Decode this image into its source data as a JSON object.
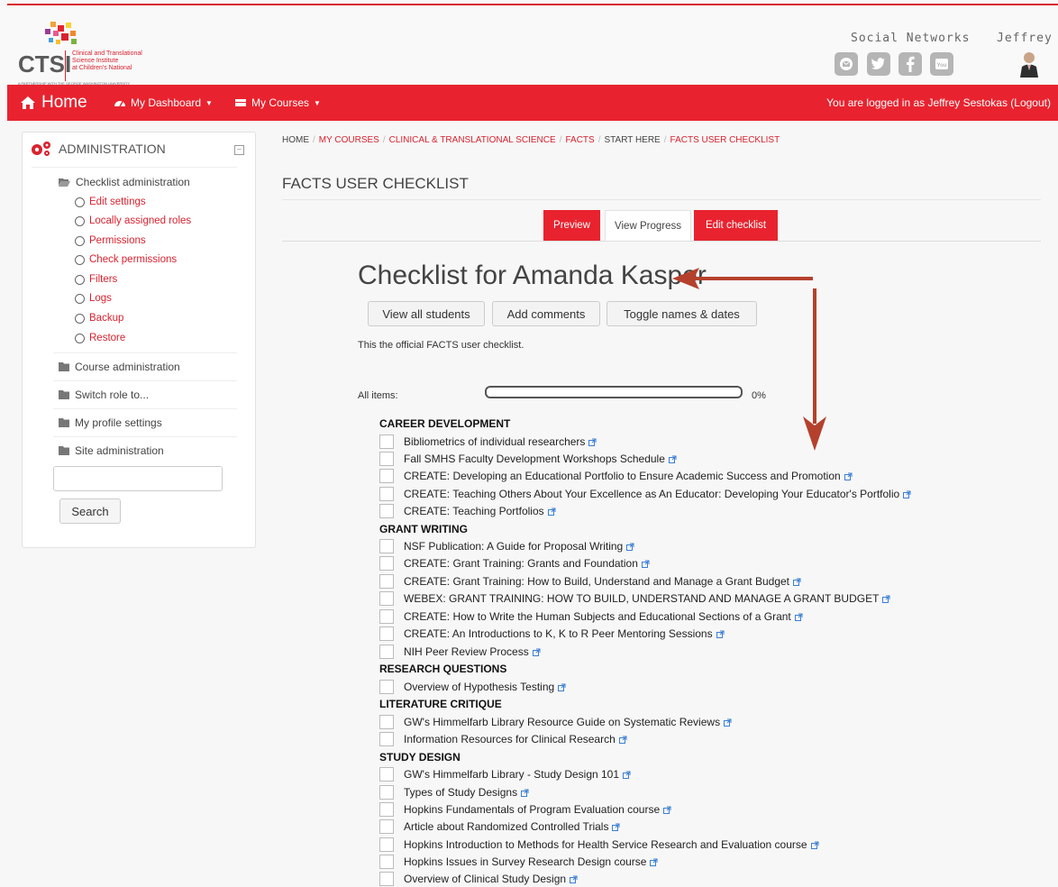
{
  "header": {
    "logo_main": "CTSI",
    "logo_sub": [
      "Clinical and Translational",
      "Science Institute",
      "at Children's National"
    ],
    "logo_foot": "A PARTNERSHIP WITH THE GEORGE WASHINGTON UNIVERSITY",
    "social_label": "Social Networks",
    "user_label": "Jeffrey",
    "social_icons": [
      "email-icon",
      "twitter-icon",
      "facebook-icon",
      "youtube-icon"
    ]
  },
  "nav": {
    "home": "Home",
    "dashboard": "My Dashboard",
    "courses": "My Courses",
    "login": "You are logged in as Jeffrey Sestokas (Logout)"
  },
  "sidebar": {
    "title": "ADMINISTRATION",
    "checklist_admin": "Checklist administration",
    "links": [
      "Edit settings",
      "Locally assigned roles",
      "Permissions",
      "Check permissions",
      "Filters",
      "Logs",
      "Backup",
      "Restore"
    ],
    "folders": [
      "Course administration",
      "Switch role to...",
      "My profile settings",
      "Site administration"
    ],
    "search_value": "",
    "search_button": "Search"
  },
  "breadcrumb": [
    "HOME",
    "MY COURSES",
    "CLINICAL & TRANSLATIONAL SCIENCE",
    "FACTS",
    "START HERE",
    "FACTS USER CHECKLIST"
  ],
  "page_title": "FACTS USER CHECKLIST",
  "tabs": [
    "Preview",
    "View Progress",
    "Edit checklist"
  ],
  "heading": "Checklist for Amanda Kasper",
  "buttons": [
    "View all students",
    "Add comments",
    "Toggle names & dates"
  ],
  "description": "This the official FACTS user checklist.",
  "progress": {
    "label": "All items:",
    "percent_text": "0%",
    "value": 0
  },
  "colors": {
    "accent": "#e8232f",
    "arrow": "#b5412c"
  },
  "checklist": [
    {
      "category": "CAREER DEVELOPMENT",
      "items": [
        "Bibliometrics of individual researchers",
        "Fall SMHS Faculty Development Workshops Schedule",
        "CREATE: Developing an Educational Portfolio to Ensure Academic Success and Promotion",
        "CREATE: Teaching Others About Your Excellence as An Educator: Developing Your Educator's Portfolio",
        "CREATE: Teaching Portfolios"
      ]
    },
    {
      "category": "GRANT WRITING",
      "items": [
        "NSF Publication: A Guide for Proposal Writing",
        "CREATE: Grant Training: Grants and Foundation",
        "CREATE: Grant Training: How to Build, Understand and Manage a Grant Budget",
        "WEBEX: GRANT TRAINING: HOW TO BUILD, UNDERSTAND AND MANAGE A GRANT BUDGET",
        "CREATE: How to Write the Human Subjects and Educational Sections of a Grant",
        "CREATE: An Introductions to K, K to R Peer Mentoring Sessions",
        "NIH Peer Review Process"
      ]
    },
    {
      "category": "RESEARCH QUESTIONS",
      "items": [
        "Overview of Hypothesis Testing"
      ]
    },
    {
      "category": "LITERATURE CRITIQUE",
      "items": [
        "GW's Himmelfarb Library Resource Guide on Systematic Reviews",
        "Information Resources for Clinical Research"
      ]
    },
    {
      "category": "STUDY DESIGN",
      "items": [
        "GW's Himmelfarb Library - Study Design 101",
        "Types of Study Designs",
        "Hopkins Fundamentals of Program Evaluation course",
        "Article about Randomized Controlled Trials",
        "Hopkins Introduction to Methods for Health Service Research and Evaluation course",
        "Hopkins Issues in Survey Research Design course",
        "Overview of Clinical Study Design"
      ]
    }
  ]
}
